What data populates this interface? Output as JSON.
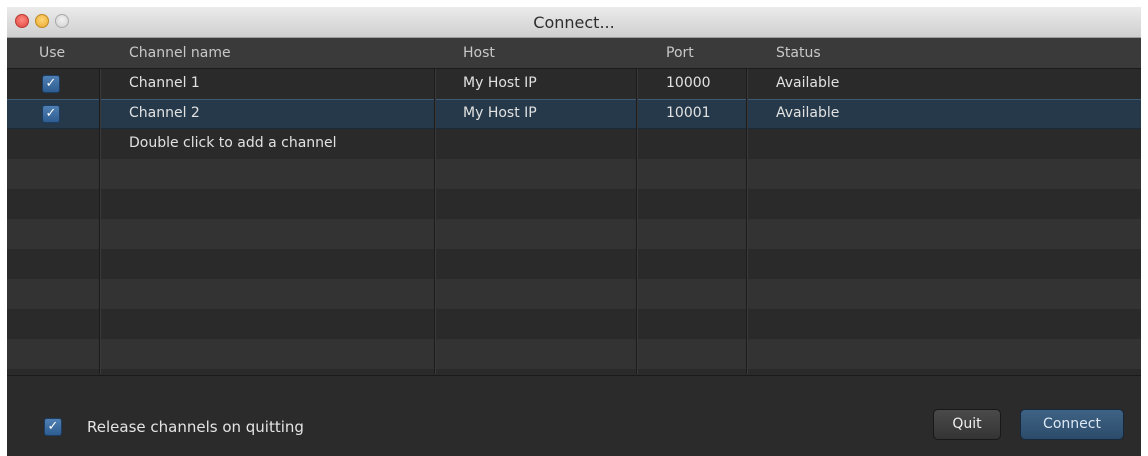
{
  "window": {
    "title": "Connect..."
  },
  "columns": {
    "use": "Use",
    "channel_name": "Channel name",
    "host": "Host",
    "port": "Port",
    "status": "Status"
  },
  "channels": [
    {
      "use": true,
      "name": "Channel 1",
      "host": "My Host IP",
      "port": "10000",
      "status": "Available",
      "selected": false
    },
    {
      "use": true,
      "name": "Channel 2",
      "host": "My Host IP",
      "port": "10001",
      "status": "Available",
      "selected": true
    }
  ],
  "add_hint": "Double click to add a channel",
  "footer": {
    "release_checked": true,
    "release_label": "Release channels on quitting",
    "quit_label": "Quit",
    "connect_label": "Connect"
  },
  "icons": {
    "check": "checkmark-icon",
    "close": "close-button",
    "minimize": "minimize-button",
    "zoom": "zoom-button"
  },
  "colors": {
    "accent": "#2e5d92",
    "selection": "#25394a"
  }
}
